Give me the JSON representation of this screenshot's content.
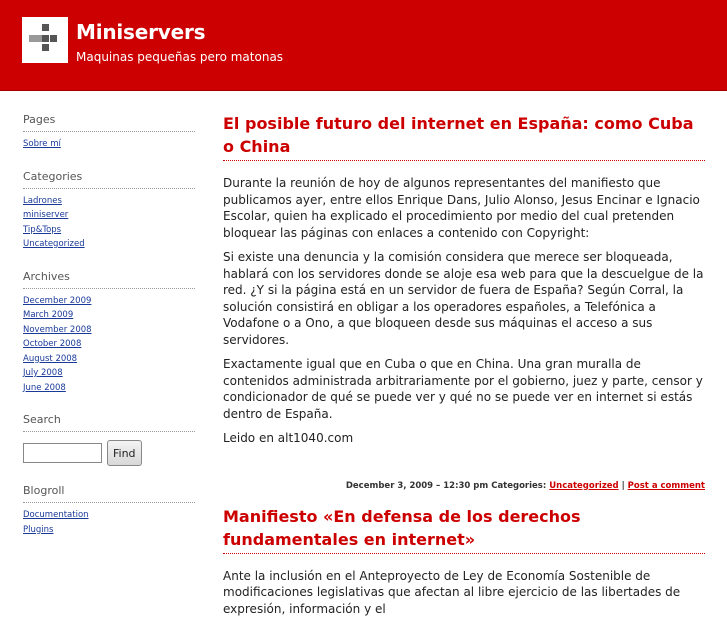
{
  "site": {
    "title": "Miniservers",
    "tagline": "Maquinas pequeñas pero matonas"
  },
  "sidebar": {
    "pages": {
      "title": "Pages",
      "items": [
        "Sobre mí"
      ]
    },
    "categories": {
      "title": "Categories",
      "items": [
        "Ladrones",
        "miniserver",
        "Tip&Tops",
        "Uncategorized"
      ]
    },
    "archives": {
      "title": "Archives",
      "items": [
        "December 2009",
        "March 2009",
        "November 2008",
        "October 2008",
        "August 2008",
        "July 2008",
        "June 2008"
      ]
    },
    "search": {
      "title": "Search",
      "button": "Find"
    },
    "blogroll": {
      "title": "Blogroll",
      "items": [
        "Documentation",
        "Plugins"
      ]
    }
  },
  "posts": [
    {
      "title": "El posible futuro del internet en España: como Cuba o China",
      "paragraphs": [
        "Durante la reunión de hoy de algunos representantes del manifiesto que publicamos ayer, entre ellos Enrique Dans, Julio Alonso, Jesus Encinar e Ignacio Escolar, quien ha explicado el procedimiento por medio del cual pretenden bloquear las páginas con enlaces a contenido con Copyright:",
        "Si existe una denuncia y la comisión considera que merece ser bloqueada, hablará con los servidores donde se aloje esa web para que la descuelgue de la red. ¿Y si la página está en un servidor de fuera de España? Según Corral, la solución consistirá en obligar a los operadores españoles, a Telefónica a Vodafone o a Ono, a que bloqueen desde sus máquinas el acceso a sus servidores.",
        "Exactamente igual que en Cuba o que en China. Una gran muralla de contenidos administrada arbitrariamente por el gobierno, juez y parte, censor y condicionador de qué se puede ver y qué no se puede ver en internet si estás dentro de España.",
        "Leido en alt1040.com"
      ],
      "meta": {
        "date": "December 3, 2009 – 12:30 pm",
        "categories_label": "Categories:",
        "category": "Uncategorized",
        "separator": "|",
        "comment_link": "Post a comment"
      }
    },
    {
      "title": "Manifiesto «En defensa de los derechos fundamentales en internet»",
      "paragraphs": [
        "Ante la inclusión en el Anteproyecto de Ley de Economía Sostenible de modificaciones legislativas que afectan al libre ejercicio de las libertades de expresión, información y el"
      ]
    }
  ],
  "colors": {
    "header_red": "#cc0000",
    "link_blue": "#1a3a9a",
    "title_red": "#cc0000"
  }
}
